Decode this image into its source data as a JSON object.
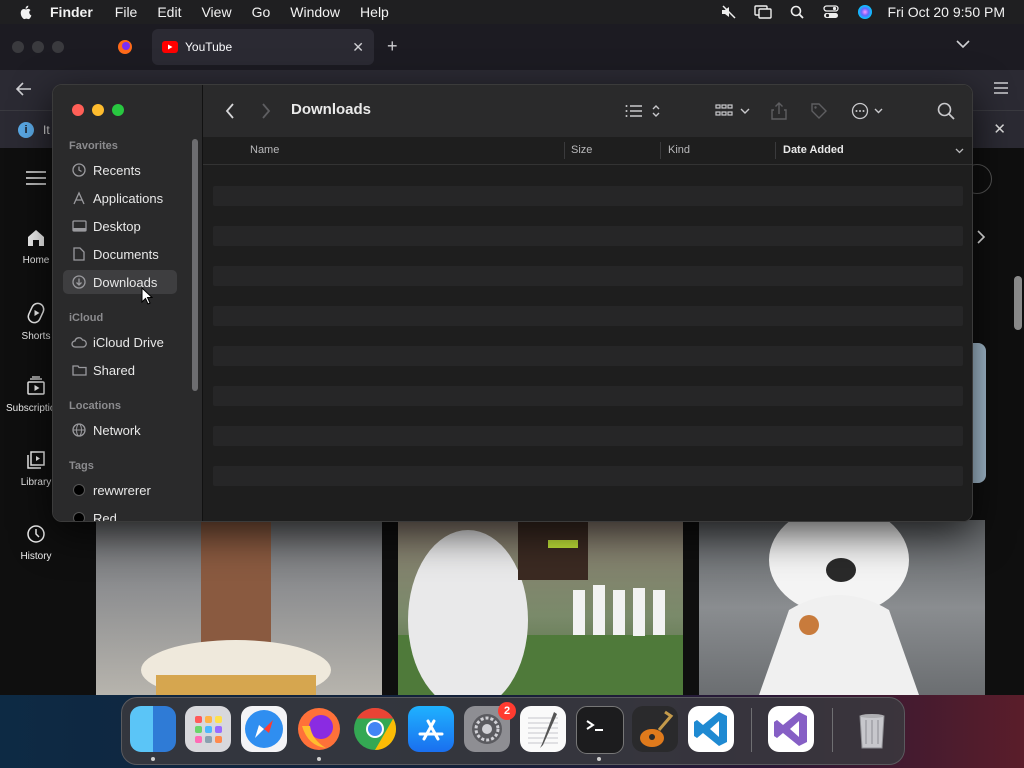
{
  "menubar": {
    "app": "Finder",
    "items": [
      "File",
      "Edit",
      "View",
      "Go",
      "Window",
      "Help"
    ],
    "clock": "Fri Oct 20  9:50 PM",
    "icons": [
      "muted-speaker-icon",
      "screen-mirroring-icon",
      "spotlight-search-icon",
      "control-center-icon",
      "siri-icon"
    ]
  },
  "browser": {
    "tab_title": "YouTube",
    "notice_text": "It",
    "sidebar": [
      {
        "label": "Home",
        "icon": "home-icon"
      },
      {
        "label": "Shorts",
        "icon": "shorts-icon"
      },
      {
        "label": "Subscriptions",
        "icon": "subscriptions-icon"
      },
      {
        "label": "Library",
        "icon": "library-icon"
      },
      {
        "label": "History",
        "icon": "history-icon"
      }
    ]
  },
  "finder": {
    "title": "Downloads",
    "sidebar": {
      "favorites_label": "Favorites",
      "favorites": [
        {
          "label": "Recents",
          "icon": "clock-icon"
        },
        {
          "label": "Applications",
          "icon": "applications-icon"
        },
        {
          "label": "Desktop",
          "icon": "desktop-icon"
        },
        {
          "label": "Documents",
          "icon": "document-icon"
        },
        {
          "label": "Downloads",
          "icon": "download-icon",
          "selected": true
        }
      ],
      "icloud_label": "iCloud",
      "icloud": [
        {
          "label": "iCloud Drive",
          "icon": "cloud-icon"
        },
        {
          "label": "Shared",
          "icon": "shared-folder-icon"
        }
      ],
      "locations_label": "Locations",
      "locations": [
        {
          "label": "Network",
          "icon": "globe-icon"
        }
      ],
      "tags_label": "Tags",
      "tags": [
        {
          "label": "rewwrerer",
          "color": "#000000"
        },
        {
          "label": "Red",
          "color": "#ff453a"
        }
      ]
    },
    "columns": {
      "name": "Name",
      "size": "Size",
      "kind": "Kind",
      "date_added": "Date Added"
    },
    "row_count": 9
  },
  "dock": {
    "apps": [
      "Finder",
      "Launchpad",
      "Safari",
      "Firefox",
      "Google Chrome",
      "App Store",
      "System Settings",
      "TextEdit",
      "Terminal",
      "GarageBand",
      "Visual Studio Code",
      "Visual Studio",
      "Trash"
    ],
    "settings_badge": "2"
  },
  "colors": {
    "close": "#ff5f57",
    "minimize": "#febc2e",
    "zoom": "#28c840",
    "selection": "#3e3e40"
  }
}
